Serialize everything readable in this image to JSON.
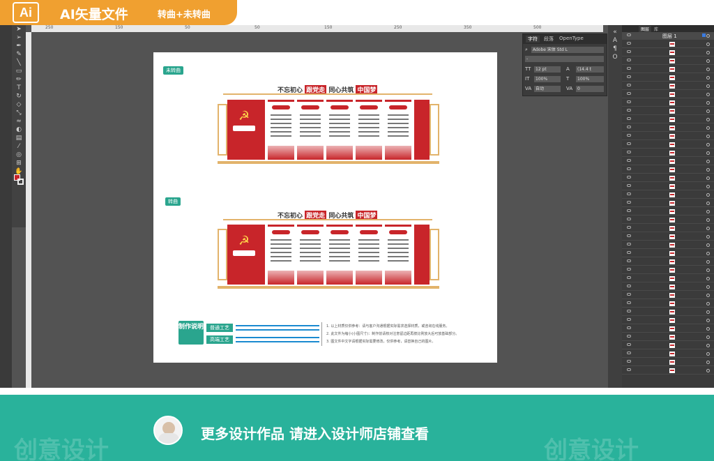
{
  "header": {
    "logo": "Ai",
    "title": "AI矢量文件",
    "subtitle": "转曲+未转曲"
  },
  "artboard": {
    "label_unconverted": "未转曲",
    "label_converted": "转曲",
    "banner": {
      "prefix": "不忘初心",
      "red1": "跟党走",
      "middle": "同心共筑",
      "red2": "中国梦"
    },
    "notes": {
      "heading": "制作说明",
      "craft_normal": "普通工艺",
      "craft_high": "高端工艺",
      "lines": [
        "1. 以上材质仅供参考：请与客户沟通根据实际需求选择材质，或咨询在线服务。",
        "2. 此文件为缩小(小图尺寸)：制作前请核对注意留边距再按比例放大后可放基础部分。",
        "3. 图文件中文字请根据实际需要修改，仅供参考，请替换自己的图片。"
      ]
    }
  },
  "character_panel": {
    "tabs": [
      "字符",
      "段落",
      "OpenType"
    ],
    "font_family": "Adobe 宋体 Std L",
    "font_style": "-",
    "font_size": "12 pt",
    "leading": "(14.4 t",
    "vertical_scale": "100%",
    "horizontal_scale": "100%",
    "kerning": "自动",
    "tracking": "0"
  },
  "layers_panel": {
    "tabs": [
      "图层",
      "库"
    ],
    "layer_name": "图层 1"
  },
  "footer": {
    "cta": "更多设计作品 请进入设计师店铺查看",
    "ghost_text": "创意设计"
  },
  "colors": {
    "accent_red": "#c8252a",
    "teal": "#29b29b",
    "badge_orange": "#f0a030",
    "gold": "#e2b36b"
  }
}
